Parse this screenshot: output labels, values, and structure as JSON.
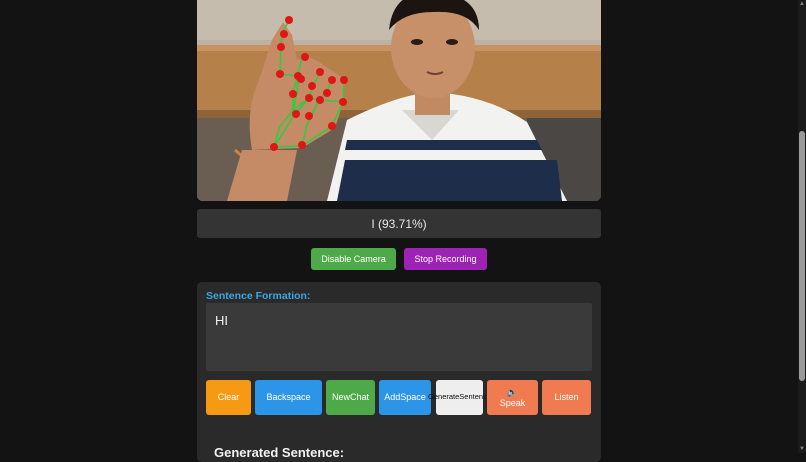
{
  "prediction": {
    "text": "I (93.71%)"
  },
  "controls": {
    "camera_label": "Disable Camera",
    "recording_label": "Stop Recording"
  },
  "sentence": {
    "title": "Sentence Formation:",
    "text": "HI"
  },
  "actions": {
    "clear": "Clear",
    "backspace": "Backspace",
    "new_chat_1": "New",
    "new_chat_2": "Chat",
    "add_space_1": "Add",
    "add_space_2": "Space",
    "generate_1": "Generate",
    "generate_2": "Sentence",
    "speak": "Speak",
    "listen": "Listen"
  },
  "generated": {
    "heading": "Generated Sentence:"
  },
  "colors": {
    "accent_title": "#3aa6df",
    "green": "#4eaa49",
    "purple": "#9d23b5",
    "orange": "#f59a12",
    "blue": "#2c95e8",
    "coral": "#f07b50"
  },
  "icons": {
    "speak": "speaker-icon"
  }
}
